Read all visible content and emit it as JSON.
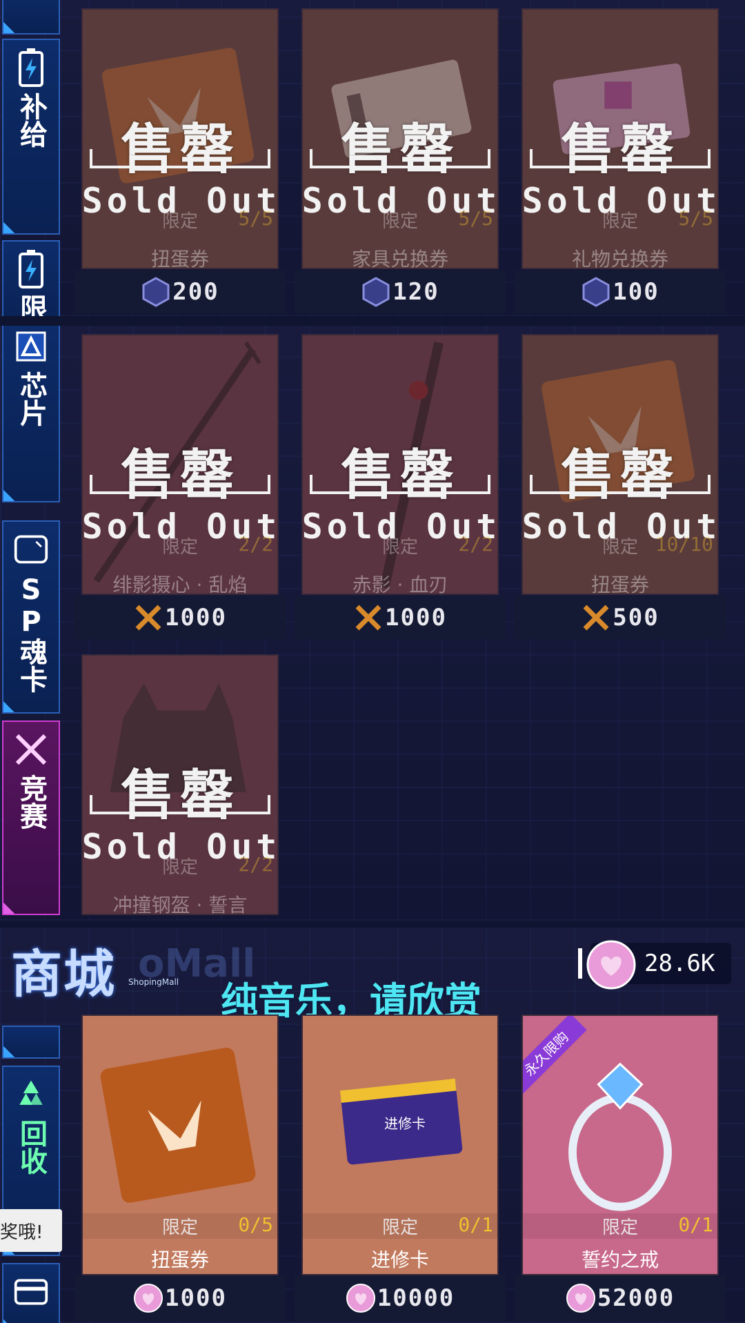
{
  "sidebar": {
    "tabs": [
      {
        "label": "补给",
        "icon": "battery-icon"
      },
      {
        "label": "限",
        "icon": "battery-icon"
      },
      {
        "label": "芯片",
        "icon": "chip-icon"
      },
      {
        "label": "SP魂卡",
        "icon": "card-icon"
      },
      {
        "label": "竞赛",
        "icon": "crossed-guns-icon"
      },
      {
        "label": "回收",
        "icon": "recycle-icon"
      }
    ]
  },
  "sold_out": {
    "cn": "售罄",
    "en": "Sold Out"
  },
  "limit_label": "限定",
  "section1": {
    "items": [
      {
        "name": "扭蛋券",
        "count": "5/5",
        "price": "200"
      },
      {
        "name": "家具兑换券",
        "count": "5/5",
        "price": "120"
      },
      {
        "name": "礼物兑换券",
        "count": "5/5",
        "price": "100"
      }
    ]
  },
  "section2": {
    "items": [
      {
        "name": "绯影摄心 · 乱焰",
        "count": "2/2",
        "price": "1000"
      },
      {
        "name": "赤影 · 血刃",
        "count": "2/2",
        "price": "1000"
      },
      {
        "name": "扭蛋券",
        "count": "10/10",
        "price": "500"
      },
      {
        "name": "冲撞钢盔 · 誓言",
        "count": "2/2",
        "price": ""
      }
    ]
  },
  "mall": {
    "title": "商城",
    "subtitle_en": "ShopingMall",
    "ghost": "oMall",
    "currency": "28.6K",
    "caption": "纯音乐，请欣赏",
    "toast": "奖哦!",
    "ribbon": "永久限购",
    "items": [
      {
        "name": "扭蛋券",
        "count": "0/5",
        "price": "1000"
      },
      {
        "name": "进修卡",
        "count": "0/1",
        "price": "10000",
        "card_text": "进修卡"
      },
      {
        "name": "誓约之戒",
        "count": "0/1",
        "price": "52000"
      }
    ]
  }
}
